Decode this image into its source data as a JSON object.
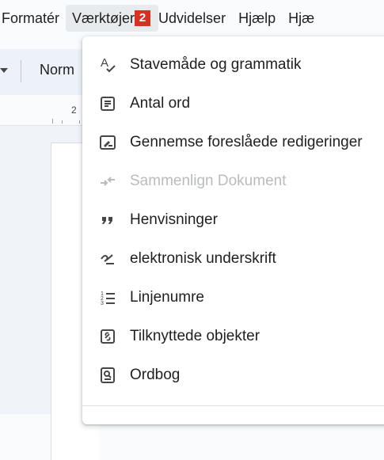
{
  "menubar": {
    "items": [
      "Formatér",
      "Værktøjer",
      "Udvidelser",
      "Hjælp",
      "Hjæ"
    ],
    "badge": "2"
  },
  "toolbar": {
    "style_label": "Norm"
  },
  "ruler": {
    "number": "2"
  },
  "menu": {
    "items": [
      {
        "label": "Stavemåde og grammatik",
        "icon": "spellcheck-icon",
        "enabled": true
      },
      {
        "label": "Antal ord",
        "icon": "word-count-icon",
        "enabled": true
      },
      {
        "label": "Gennemse foreslåede redigeringer",
        "icon": "review-edits-icon",
        "enabled": true
      },
      {
        "label": "Sammenlign Dokument",
        "icon": "compare-icon",
        "enabled": false
      },
      {
        "label": "Henvisninger",
        "icon": "quote-icon",
        "enabled": true
      },
      {
        "label": "elektronisk underskrift",
        "icon": "signature-icon",
        "enabled": true
      },
      {
        "label": "Linjenumre",
        "icon": "line-numbers-icon",
        "enabled": true
      },
      {
        "label": "Tilknyttede objekter",
        "icon": "linked-objects-icon",
        "enabled": true
      },
      {
        "label": "Ordbog",
        "icon": "dictionary-icon",
        "enabled": true
      }
    ]
  },
  "colors": {
    "accent_badge": "#d93025",
    "disabled_text": "#b9bbbe",
    "active_menu_bg": "#e8ebee"
  }
}
